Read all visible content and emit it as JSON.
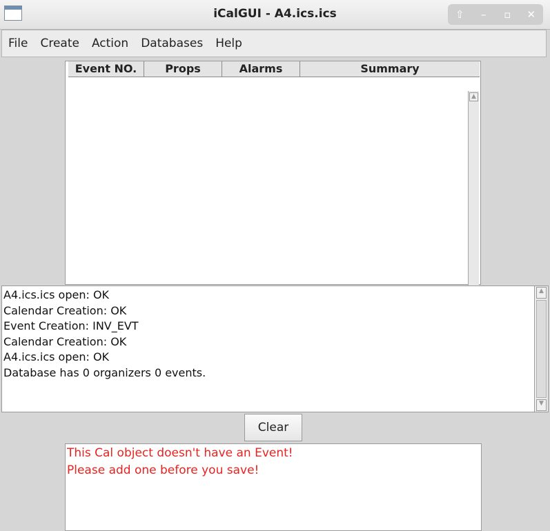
{
  "window": {
    "title": "iCalGUI - A4.ics.ics",
    "controls": {
      "up": "⇧",
      "minimize": "–",
      "maximize": "▫",
      "close": "✕"
    }
  },
  "menu": [
    "File",
    "Create",
    "Action",
    "Databases",
    "Help"
  ],
  "table": {
    "columns": [
      "Event NO.",
      "Props",
      "Alarms",
      "Summary"
    ]
  },
  "log": {
    "lines": [
      "A4.ics.ics open: OK",
      "Calendar Creation: OK",
      "Event Creation: INV_EVT",
      "Calendar Creation: OK",
      "A4.ics.ics open: OK",
      "Database has 0 organizers 0 events."
    ]
  },
  "clear_label": "Clear",
  "message": {
    "color": "#e8231f",
    "lines": [
      "This Cal object doesn't have an Event!",
      "Please add one before you save!"
    ]
  }
}
